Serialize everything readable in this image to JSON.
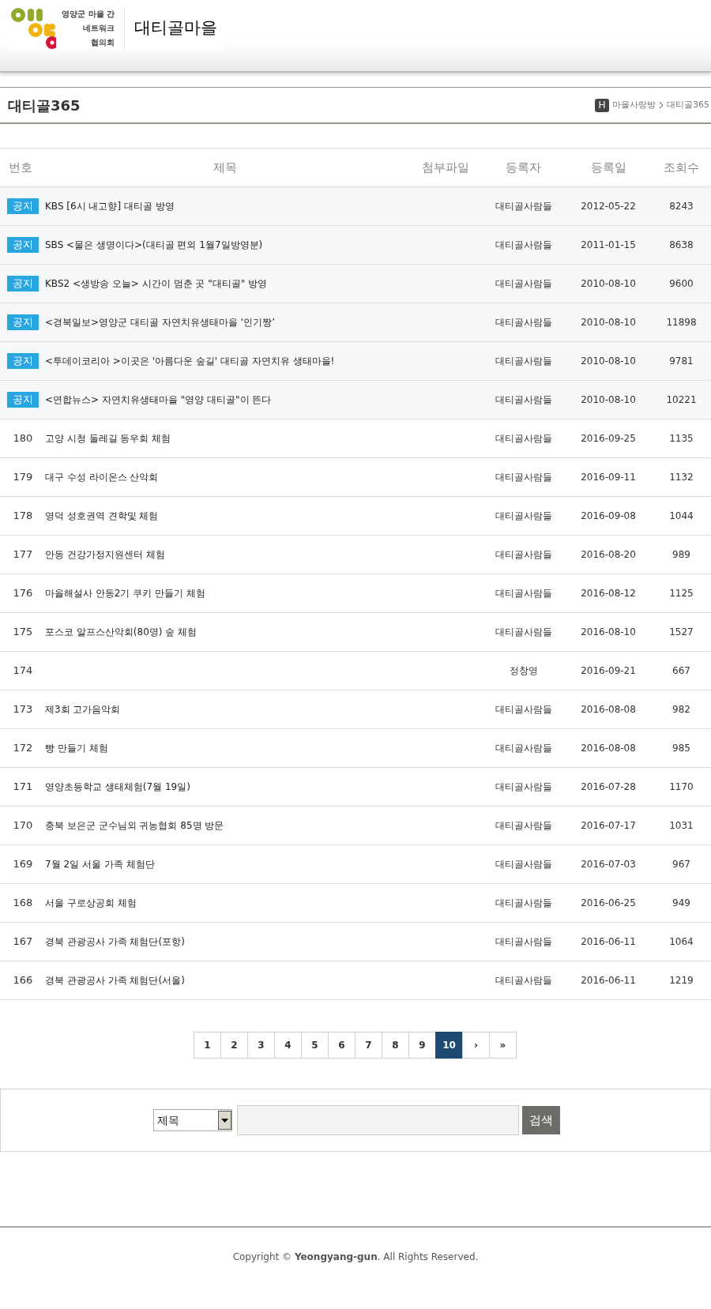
{
  "logo": {
    "lines": [
      "영양군 마을 간",
      "네트워크",
      "협의회"
    ]
  },
  "site_title": "대티골마을",
  "page_title": "대티골365",
  "breadcrumb": {
    "home": "H",
    "items": [
      "마을사랑방",
      "대티골365"
    ]
  },
  "table": {
    "columns": [
      "번호",
      "제목",
      "첨부파일",
      "등록자",
      "등록일",
      "조회수"
    ],
    "rows": [
      {
        "kind": "notice",
        "number": "공지",
        "title": "KBS [6시 내고향] 대티골 방영",
        "author": "대티골사람들",
        "date": "2012-05-22",
        "views": "8243"
      },
      {
        "kind": "notice",
        "number": "공지",
        "title": "SBS <물은 생명이다>(대티골 편외 1월7일방영분)",
        "author": "대티골사람들",
        "date": "2011-01-15",
        "views": "8638"
      },
      {
        "kind": "notice",
        "number": "공지",
        "title": "KBS2 <생방송 오늘> 시간이 멈춘 곳 \"대티골\" 방영",
        "author": "대티골사람들",
        "date": "2010-08-10",
        "views": "9600"
      },
      {
        "kind": "notice",
        "number": "공지",
        "title": "<경북일보>영양군 대티골 자연치유생태마을 ‘인기짱’",
        "author": "대티골사람들",
        "date": "2010-08-10",
        "views": "11898"
      },
      {
        "kind": "notice",
        "number": "공지",
        "title": "<투데이코리아 >이곳은 '아름다운 숲길' 대티골 자연치유 생태마을!",
        "author": "대티골사람들",
        "date": "2010-08-10",
        "views": "9781"
      },
      {
        "kind": "notice",
        "number": "공지",
        "title": "<연합뉴스> 자연치유생태마을 \"영양 대티골\"이 뜬다",
        "author": "대티골사람들",
        "date": "2010-08-10",
        "views": "10221"
      },
      {
        "kind": "post",
        "number": "180",
        "title": "고양 시청 둘레길 동우회 체험",
        "author": "대티골사람들",
        "date": "2016-09-25",
        "views": "1135"
      },
      {
        "kind": "post",
        "number": "179",
        "title": "대구 수성 라이온스 산악회",
        "author": "대티골사람들",
        "date": "2016-09-11",
        "views": "1132"
      },
      {
        "kind": "post",
        "number": "178",
        "title": "영덕 성호권역 견학및 체험",
        "author": "대티골사람들",
        "date": "2016-09-08",
        "views": "1044"
      },
      {
        "kind": "post",
        "number": "177",
        "title": "안동 건강가정지원센터 체험",
        "author": "대티골사람들",
        "date": "2016-08-20",
        "views": "989"
      },
      {
        "kind": "post",
        "number": "176",
        "title": "마을해설사 안동2기 쿠키 만들기 체험",
        "author": "대티골사람들",
        "date": "2016-08-12",
        "views": "1125"
      },
      {
        "kind": "post",
        "number": "175",
        "title": "포스코 알프스산악회(80명) 숲 체험",
        "author": "대티골사람들",
        "date": "2016-08-10",
        "views": "1527"
      },
      {
        "kind": "post",
        "number": "174",
        "author": "정창영",
        "date": "2016-09-21",
        "views": "667"
      },
      {
        "kind": "post",
        "number": "173",
        "title": "제3회 고가음악회",
        "author": "대티골사람들",
        "date": "2016-08-08",
        "views": "982"
      },
      {
        "kind": "post",
        "number": "172",
        "title": "빵 만들기 체험",
        "author": "대티골사람들",
        "date": "2016-08-08",
        "views": "985"
      },
      {
        "kind": "post",
        "number": "171",
        "title": "영양초등학교 생태체험(7월 19일)",
        "author": "대티골사람들",
        "date": "2016-07-28",
        "views": "1170"
      },
      {
        "kind": "post",
        "number": "170",
        "title": "충북 보은군 군수님외 귀농협회 85명 방문",
        "author": "대티골사람들",
        "date": "2016-07-17",
        "views": "1031"
      },
      {
        "kind": "post",
        "number": "169",
        "title": "7월 2일 서울 가족 체험단",
        "author": "대티골사람들",
        "date": "2016-07-03",
        "views": "967"
      },
      {
        "kind": "post",
        "number": "168",
        "title": "서울 구로상공회 체험",
        "author": "대티골사람들",
        "date": "2016-06-25",
        "views": "949"
      },
      {
        "kind": "post",
        "number": "167",
        "title": "경북 관광공사 가족 체험단(포항)",
        "author": "대티골사람들",
        "date": "2016-06-11",
        "views": "1064"
      },
      {
        "kind": "post",
        "number": "166",
        "title": "경북 관광공사 가족 체험단(서울)",
        "author": "대티골사람들",
        "date": "2016-06-11",
        "views": "1219"
      }
    ]
  },
  "pagination": [
    {
      "label": "1",
      "selected": false
    },
    {
      "label": "2",
      "selected": false
    },
    {
      "label": "3",
      "selected": false
    },
    {
      "label": "4",
      "selected": false
    },
    {
      "label": "5",
      "selected": false
    },
    {
      "label": "6",
      "selected": false
    },
    {
      "label": "7",
      "selected": false
    },
    {
      "label": "8",
      "selected": false
    },
    {
      "label": "9",
      "selected": false
    },
    {
      "label": "10",
      "selected": true
    },
    {
      "label": "›",
      "selected": false
    },
    {
      "label": "»",
      "selected": false
    }
  ],
  "search": {
    "field_select": "제목",
    "button": "검색"
  },
  "footer": {
    "copyright": "Copyright © **Yeongyang-gun**. All Rights Reserved."
  }
}
